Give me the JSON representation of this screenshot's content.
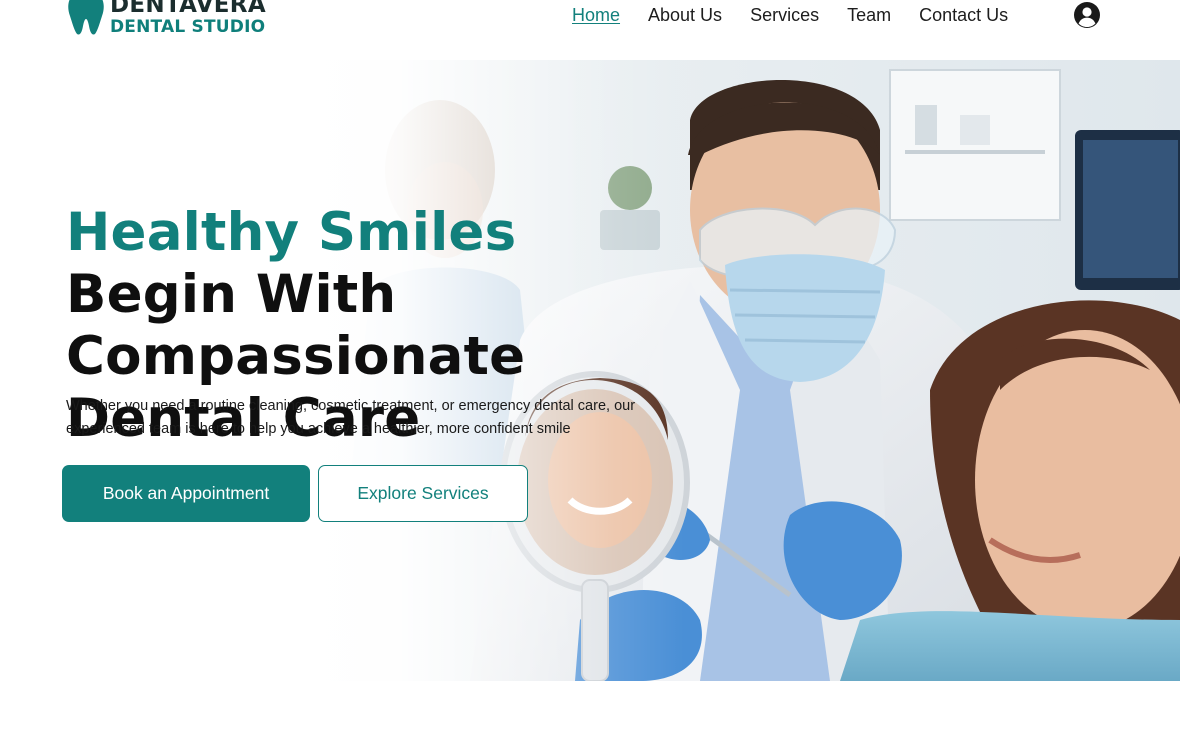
{
  "brand": {
    "name_line1": "DENTAVERA",
    "name_line2": "DENTAL STUDIO",
    "primary_color": "#12807c",
    "dark_color": "#1b2d2e",
    "logo_icon": "tooth-icon"
  },
  "nav": {
    "items": [
      {
        "label": "Home",
        "active": true
      },
      {
        "label": "About Us",
        "active": false
      },
      {
        "label": "Services",
        "active": false
      },
      {
        "label": "Team",
        "active": false
      },
      {
        "label": "Contact Us",
        "active": false
      }
    ],
    "account_icon": "user-account-icon"
  },
  "hero": {
    "title_accent": "Healthy Smiles",
    "title_rest": "Begin With Compassionate Dental Care",
    "subtitle": "Whether you need a routine cleaning, cosmetic treatment, or emergency dental care, our experienced team is here to help you achieve a healthier, more confident smile",
    "primary_button": "Book an Appointment",
    "secondary_button": "Explore Services",
    "image_subject": "dentist-with-patient-holding-mirror"
  }
}
